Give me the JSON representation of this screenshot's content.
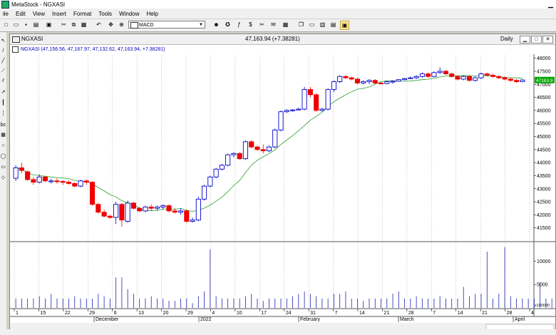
{
  "app": {
    "title": "MetaStock - NGXASI"
  },
  "menu": [
    "ile",
    "Edit",
    "View",
    "Insert",
    "Format",
    "Tools",
    "Window",
    "Help"
  ],
  "toolbar": {
    "combo_value": "MACD"
  },
  "window": {
    "symbol": "NGXASI",
    "last": "47,163.94 (+7.38281)",
    "period": "Daily"
  },
  "infobar": {
    "text": "NGXASI (47,156.56, 47,167.97, 47,132.62, 47,163.94, +7.38281)"
  },
  "price_axis": {
    "labels": [
      "48000",
      "47500",
      "47000",
      "46500",
      "46000",
      "45500",
      "45000",
      "44500",
      "44000",
      "43500",
      "43000",
      "42500",
      "42000",
      "41500"
    ],
    "current_label": "47163.9"
  },
  "volume_axis": {
    "labels": [
      "10000",
      "5000"
    ],
    "unit": "x100000"
  },
  "time_axis": {
    "ticks": [
      "1",
      "15",
      "22",
      "29",
      "6",
      "13",
      "20",
      "29",
      "4",
      "10",
      "17",
      "24",
      "31",
      "7",
      "14",
      "21",
      "28",
      "7",
      "14",
      "21",
      "28",
      "4"
    ],
    "months": [
      "December",
      "2022",
      "February",
      "March",
      "April"
    ]
  },
  "colors": {
    "up": "#0000cc",
    "down": "#ee0000",
    "ma": "#2ea02e",
    "volume": "#2020b0"
  },
  "chart_data": {
    "type": "candlestick",
    "ylim": [
      41000,
      48100
    ],
    "candles": [
      [
        43400,
        43900,
        43300,
        43800
      ],
      [
        43800,
        44000,
        43600,
        43700
      ],
      [
        43650,
        43700,
        43300,
        43350
      ],
      [
        43350,
        43450,
        43150,
        43250
      ],
      [
        43250,
        43550,
        43200,
        43450
      ],
      [
        43450,
        43500,
        43250,
        43300
      ],
      [
        43300,
        43380,
        43200,
        43300
      ],
      [
        43300,
        43400,
        43200,
        43280
      ],
      [
        43280,
        43320,
        43150,
        43250
      ],
      [
        43250,
        43320,
        43150,
        43200
      ],
      [
        43200,
        43250,
        43050,
        43100
      ],
      [
        43100,
        43350,
        43050,
        43300
      ],
      [
        43300,
        43350,
        43150,
        43250
      ],
      [
        43250,
        43280,
        42350,
        42400
      ],
      [
        42400,
        42450,
        42050,
        42100
      ],
      [
        42100,
        42200,
        41900,
        41950
      ],
      [
        41950,
        42000,
        41850,
        41900
      ],
      [
        41900,
        42500,
        41650,
        42400
      ],
      [
        42400,
        42450,
        41550,
        41800
      ],
      [
        41750,
        42550,
        41700,
        42450
      ],
      [
        42450,
        42500,
        42200,
        42250
      ],
      [
        42250,
        42300,
        42100,
        42150
      ],
      [
        42150,
        42350,
        42100,
        42300
      ],
      [
        42300,
        42400,
        42150,
        42250
      ],
      [
        42250,
        42350,
        42150,
        42300
      ],
      [
        42300,
        42400,
        42200,
        42350
      ],
      [
        42350,
        42400,
        42100,
        42150
      ],
      [
        42150,
        42250,
        42050,
        42100
      ],
      [
        42100,
        42250,
        42000,
        42150
      ],
      [
        42150,
        42200,
        41700,
        41750
      ],
      [
        41750,
        41900,
        41700,
        41800
      ],
      [
        41800,
        42700,
        41750,
        42600
      ],
      [
        42600,
        43150,
        42550,
        43100
      ],
      [
        43100,
        43500,
        43050,
        43450
      ],
      [
        43450,
        43800,
        43400,
        43750
      ],
      [
        43750,
        43950,
        43700,
        43900
      ],
      [
        43900,
        44350,
        43850,
        44300
      ],
      [
        44300,
        44400,
        44200,
        44350
      ],
      [
        44350,
        44400,
        44100,
        44150
      ],
      [
        44150,
        44850,
        44100,
        44800
      ],
      [
        44800,
        44850,
        44550,
        44600
      ],
      [
        44600,
        44650,
        44450,
        44500
      ],
      [
        44500,
        44700,
        44350,
        44450
      ],
      [
        44450,
        44650,
        44400,
        44600
      ],
      [
        44600,
        45300,
        44550,
        45250
      ],
      [
        45250,
        46000,
        45200,
        45950
      ],
      [
        45950,
        46050,
        45900,
        46000
      ],
      [
        46000,
        46050,
        45950,
        46020
      ],
      [
        46020,
        46100,
        46000,
        46050
      ],
      [
        46050,
        46900,
        46000,
        46800
      ],
      [
        46800,
        46900,
        46500,
        46600
      ],
      [
        46600,
        46650,
        45950,
        46000
      ],
      [
        46000,
        46100,
        45950,
        46050
      ],
      [
        46050,
        46850,
        46000,
        46800
      ],
      [
        46800,
        47150,
        46700,
        47100
      ],
      [
        47100,
        47350,
        47050,
        47300
      ],
      [
        47300,
        47350,
        47200,
        47250
      ],
      [
        47250,
        47300,
        47150,
        47200
      ],
      [
        47200,
        47250,
        47000,
        47050
      ],
      [
        47050,
        47150,
        47000,
        47100
      ],
      [
        47100,
        47200,
        47000,
        47150
      ],
      [
        47150,
        47200,
        47000,
        47050
      ],
      [
        47050,
        47100,
        47000,
        47030
      ],
      [
        47030,
        47150,
        47000,
        47100
      ],
      [
        47100,
        47150,
        47020,
        47120
      ],
      [
        47120,
        47200,
        47100,
        47180
      ],
      [
        47180,
        47250,
        47150,
        47220
      ],
      [
        47220,
        47300,
        47200,
        47250
      ],
      [
        47250,
        47350,
        47200,
        47300
      ],
      [
        47300,
        47450,
        47250,
        47400
      ],
      [
        47400,
        47450,
        47250,
        47300
      ],
      [
        47300,
        47500,
        47280,
        47450
      ],
      [
        47450,
        47650,
        47400,
        47500
      ],
      [
        47500,
        47550,
        47350,
        47400
      ],
      [
        47400,
        47450,
        47250,
        47300
      ],
      [
        47300,
        47350,
        47150,
        47200
      ],
      [
        47200,
        47350,
        47150,
        47300
      ],
      [
        47300,
        47350,
        47100,
        47150
      ],
      [
        47150,
        47300,
        47100,
        47250
      ],
      [
        47250,
        47450,
        47200,
        47400
      ],
      [
        47400,
        47450,
        47300,
        47350
      ],
      [
        47350,
        47400,
        47250,
        47300
      ],
      [
        47300,
        47350,
        47200,
        47250
      ],
      [
        47250,
        47300,
        47150,
        47200
      ],
      [
        47200,
        47250,
        47100,
        47150
      ],
      [
        47150,
        47200,
        47050,
        47100
      ],
      [
        47100,
        47200,
        47080,
        47164
      ]
    ],
    "volumes": [
      2,
      2,
      2,
      2,
      2.5,
      2,
      3,
      2,
      2,
      2,
      2.5,
      2,
      2,
      2,
      3,
      2.5,
      2,
      6.5,
      6.5,
      4,
      3,
      2,
      2,
      2.5,
      2,
      2,
      1.5,
      1.5,
      2,
      2,
      1,
      2.5,
      3.5,
      12.5,
      2.5,
      2,
      2,
      2,
      2,
      2.5,
      3,
      2,
      1.5,
      2,
      2,
      2,
      2,
      2.5,
      3,
      3.5,
      3,
      2.5,
      2,
      2,
      3,
      3,
      3.5,
      2,
      2,
      1.5,
      2,
      2,
      2,
      2,
      3,
      3.5,
      2,
      2,
      2.5,
      2,
      2,
      2,
      2.5,
      2,
      2,
      2,
      4.5,
      2.5,
      3,
      3,
      12,
      2,
      3,
      13,
      2.5,
      2,
      2,
      2,
      2,
      5.5,
      2,
      2,
      2
    ]
  }
}
